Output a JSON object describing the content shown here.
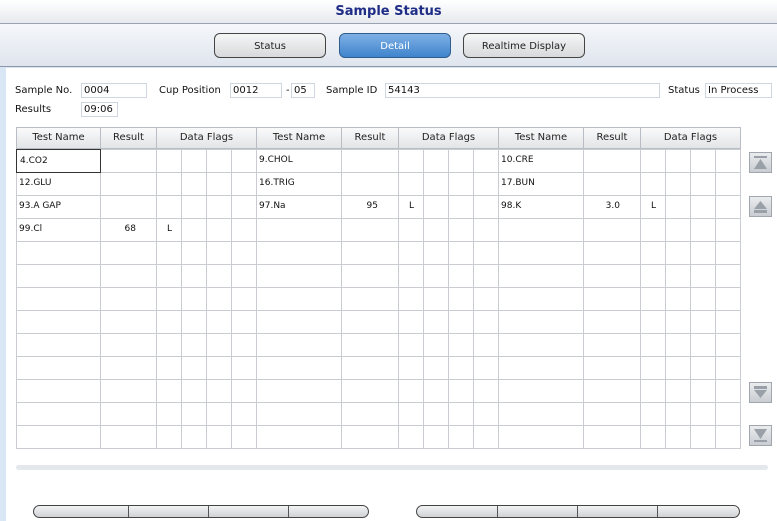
{
  "window": {
    "title": "Sample Status"
  },
  "tabs": [
    {
      "label": "Status",
      "active": false
    },
    {
      "label": "Detail",
      "active": true
    },
    {
      "label": "Realtime Display",
      "active": false
    }
  ],
  "info": {
    "sample_no_label": "Sample No.",
    "sample_no": "0004",
    "cup_position_label": "Cup Position",
    "cup_position": "0012",
    "cup_position_sep": "-",
    "cup_sub": "05",
    "sample_id_label": "Sample ID",
    "sample_id": "54143",
    "status_label": "Status",
    "status": "In Process",
    "results_label": "Results",
    "results": "09:06"
  },
  "table": {
    "headers": [
      "Test Name",
      "Result",
      "Data Flags",
      "Test Name",
      "Result",
      "Data Flags",
      "Test Name",
      "Result",
      "Data Flags"
    ],
    "rows": [
      [
        {
          "name": "4.CO2",
          "result": "",
          "flag": ""
        },
        {
          "name": "9.CHOL",
          "result": "",
          "flag": ""
        },
        {
          "name": "10.CRE",
          "result": "",
          "flag": ""
        }
      ],
      [
        {
          "name": "12.GLU",
          "result": "",
          "flag": ""
        },
        {
          "name": "16.TRIG",
          "result": "",
          "flag": ""
        },
        {
          "name": "17.BUN",
          "result": "",
          "flag": ""
        }
      ],
      [
        {
          "name": "93.A GAP",
          "result": "",
          "flag": ""
        },
        {
          "name": "97.Na",
          "result": "95",
          "flag": "L"
        },
        {
          "name": "98.K",
          "result": "3.0",
          "flag": "L"
        }
      ],
      [
        {
          "name": "99.Cl",
          "result": "68",
          "flag": "L"
        },
        {
          "name": "",
          "result": "",
          "flag": ""
        },
        {
          "name": "",
          "result": "",
          "flag": ""
        }
      ]
    ],
    "total_rows": 13
  },
  "nav_buttons": [
    {
      "name": "scroll-top-button",
      "icon": "first-page-icon"
    },
    {
      "name": "scroll-up-button",
      "icon": "page-up-icon"
    },
    {
      "name": "scroll-down-button",
      "icon": "page-down-icon"
    },
    {
      "name": "scroll-bottom-button",
      "icon": "last-page-icon"
    }
  ],
  "colors": {
    "title": "#1f2d86",
    "active_tab": "#4a8fd4",
    "background": "#d9e6f5"
  }
}
